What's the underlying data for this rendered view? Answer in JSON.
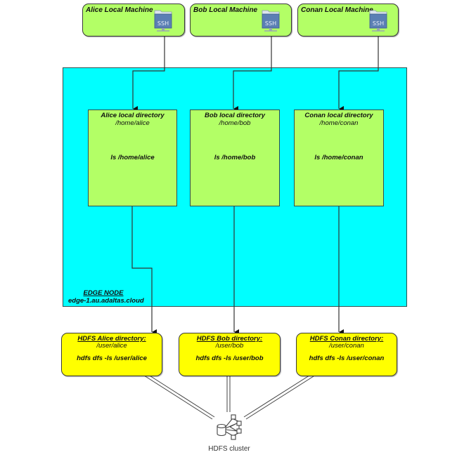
{
  "machines": [
    {
      "name": "Alice Local Machine",
      "icon": "ssh-folder-icon",
      "icon_label": "SSH"
    },
    {
      "name": "Bob Local Machine",
      "icon": "ssh-folder-icon",
      "icon_label": "SSH"
    },
    {
      "name": "Conan Local Machine",
      "icon": "ssh-folder-icon",
      "icon_label": "SSH"
    }
  ],
  "edge_node": {
    "title": "EDGE NODE",
    "host": "edge-1.au.adaltas.cloud",
    "local_dirs": [
      {
        "title": "Alice local directory",
        "path": "/home/alice",
        "command": "ls /home/alice"
      },
      {
        "title": "Bob local directory",
        "path": "/home/bob",
        "command": "ls /home/bob"
      },
      {
        "title": "Conan local directory",
        "path": "/home/conan",
        "command": "ls /home/conan"
      }
    ]
  },
  "hdfs_dirs": [
    {
      "title": "HDFS Alice directory:",
      "path": "/user/alice",
      "command": "hdfs dfs -ls /user/alice"
    },
    {
      "title": "HDFS Bob directory:",
      "path": "/user/bob",
      "command": "hdfs dfs -ls /user/bob"
    },
    {
      "title": "HDFS Conan directory:",
      "path": "/user/conan",
      "command": "hdfs dfs -ls /user/conan"
    }
  ],
  "cluster": {
    "label": "HDFS cluster",
    "icon": "hdfs-cluster-icon"
  },
  "colors": {
    "machine_fill": "#b3ff66",
    "edge_node_fill": "#00ffff",
    "hdfs_fill": "#ffff00",
    "line": "#333333"
  }
}
